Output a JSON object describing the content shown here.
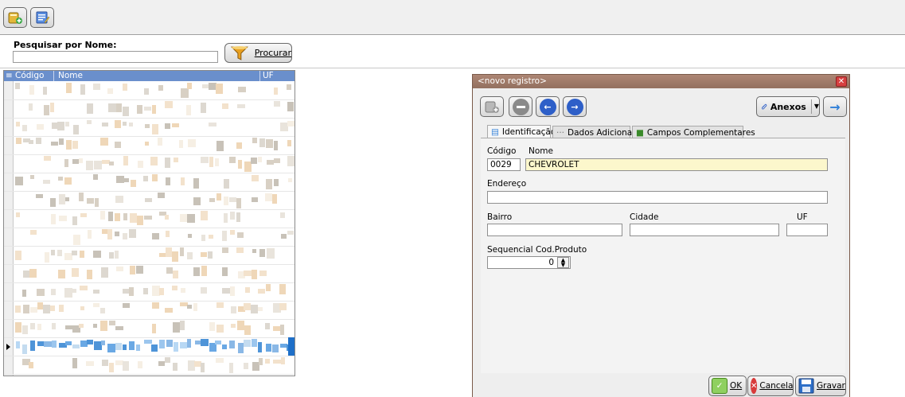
{
  "toolbar": {
    "icons": [
      "new-record-icon",
      "edit-record-icon"
    ]
  },
  "search": {
    "label": "Pesquisar por Nome:",
    "value": "",
    "button_label": "Procurar"
  },
  "grid": {
    "columns": [
      "Código",
      "Nome",
      "UF"
    ],
    "selected_row_index": 14
  },
  "dialog": {
    "title": "<novo registro>",
    "tools": [
      "add-record-icon",
      "remove-record-icon",
      "previous-record-icon",
      "next-record-icon"
    ],
    "attachments_label": "Anexos",
    "tabs": [
      {
        "label": "Identificação",
        "icon": "form-icon"
      },
      {
        "label": "Dados Adicionais",
        "icon": "dots-icon"
      },
      {
        "label": "Campos Complementares",
        "icon": "folder-icon"
      }
    ],
    "fields": {
      "codigo_label": "Código",
      "codigo_value": "0029",
      "nome_label": "Nome",
      "nome_value": "CHEVROLET",
      "endereco_label": "Endereço",
      "endereco_value": "",
      "bairro_label": "Bairro",
      "bairro_value": "",
      "cidade_label": "Cidade",
      "cidade_value": "",
      "uf_label": "UF",
      "uf_value": "",
      "seq_label": "Sequencial Cod.Produto",
      "seq_value": "0"
    },
    "footer": {
      "ok_label": "OK",
      "cancel_label": "Cancelar",
      "save_label": "Gravar"
    }
  },
  "colors": {
    "accent": "#6a8fcc",
    "title_bar": "#a07a68",
    "selection": "#3a8ad8",
    "highlight_field": "#fcf7cc"
  }
}
